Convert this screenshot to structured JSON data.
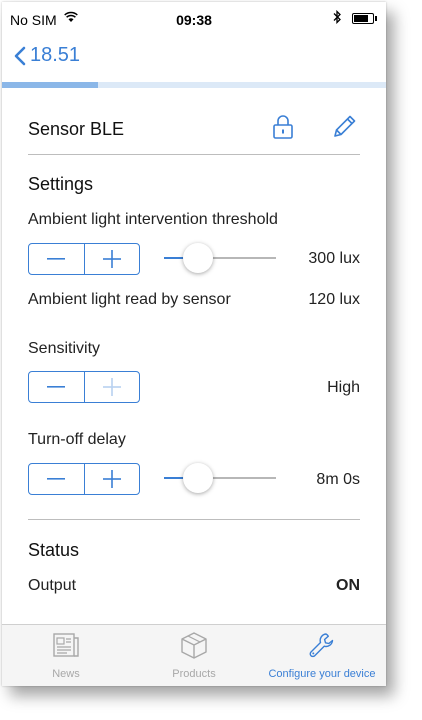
{
  "status_bar": {
    "carrier": "No SIM",
    "time": "09:38"
  },
  "nav": {
    "back_label": "18.51",
    "progress_fraction": 0.25
  },
  "device": {
    "name": "Sensor BLE"
  },
  "settings": {
    "title": "Settings",
    "ambient_threshold": {
      "label": "Ambient light intervention threshold",
      "value": "300 lux",
      "slider_fraction": 0.3
    },
    "ambient_read": {
      "label": "Ambient light read by sensor",
      "value": "120 lux"
    },
    "sensitivity": {
      "label": "Sensitivity",
      "value": "High",
      "plus_disabled": true
    },
    "turnoff_delay": {
      "label": "Turn-off delay",
      "value": "8m 0s",
      "slider_fraction": 0.3
    }
  },
  "status": {
    "title": "Status",
    "output_label": "Output",
    "output_value": "ON"
  },
  "tabs": [
    {
      "label": "News",
      "icon": "newspaper-icon",
      "active": false
    },
    {
      "label": "Products",
      "icon": "box-icon",
      "active": false
    },
    {
      "label": "Configure your device",
      "icon": "wrench-icon",
      "active": true
    }
  ],
  "colors": {
    "accent": "#3a7fd5",
    "inactive": "#a8a8a8"
  }
}
